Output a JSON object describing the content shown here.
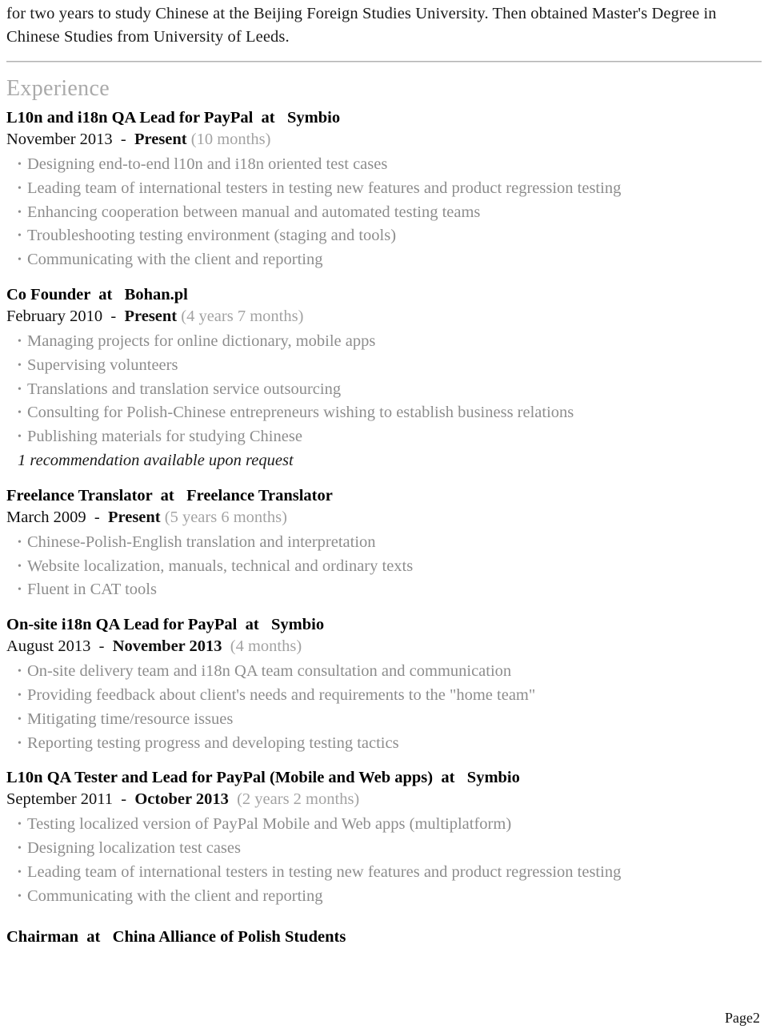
{
  "document": {
    "intro_paragraph": "for two years to study Chinese at the Beijing Foreign Studies University. Then obtained Master's Degree in Chinese Studies from University of Leeds.",
    "footer_page_label": "Page2"
  },
  "experience": {
    "section_title": "Experience",
    "bullet_glyph": "•",
    "jobs": [
      {
        "title": "L10n and i18n QA Lead for PayPal  at   Symbio",
        "date_start": "November 2013  -  ",
        "date_end": "Present",
        "date_end_bold": true,
        "duration": " (10 months)",
        "bullets": [
          "Designing end-to-end l10n and i18n oriented test cases",
          "Leading team of international testers in testing new features and product regression testing",
          "Enhancing cooperation between manual and automated testing teams",
          "Troubleshooting testing environment (staging and tools)",
          "Communicating with the client and reporting"
        ],
        "recommendation": null
      },
      {
        "title": "Co Founder  at   Bohan.pl",
        "date_start": "February 2010  -  ",
        "date_end": "Present",
        "date_end_bold": true,
        "duration": " (4 years 7 months)",
        "bullets": [
          "Managing projects for online dictionary, mobile apps",
          "Supervising volunteers",
          "Translations and translation service outsourcing",
          "Consulting for Polish-Chinese entrepreneurs wishing to establish business relations",
          "Publishing materials for studying Chinese"
        ],
        "recommendation": "1 recommendation available upon request"
      },
      {
        "title": "Freelance Translator  at   Freelance Translator",
        "date_start": "March 2009  -  ",
        "date_end": "Present",
        "date_end_bold": true,
        "duration": " (5 years 6 months)",
        "bullets": [
          "Chinese-Polish-English translation and interpretation",
          "Website localization, manuals, technical and ordinary texts",
          "Fluent in CAT tools"
        ],
        "recommendation": null
      },
      {
        "title": "On-site i18n QA Lead for PayPal  at   Symbio",
        "date_start": "August 2013  -  ",
        "date_end": "November 2013",
        "date_end_bold": true,
        "duration": "  (4 months)",
        "bullets": [
          "On-site delivery team and i18n QA team consultation and communication",
          "Providing feedback about client's needs and requirements to the \"home team\"",
          "Mitigating time/resource issues",
          "Reporting testing progress and developing testing tactics"
        ],
        "recommendation": null
      },
      {
        "title": "L10n QA Tester and Lead for PayPal (Mobile and Web apps)  at   Symbio",
        "date_start": "September 2011  -  ",
        "date_end": "October 2013",
        "date_end_bold": true,
        "duration": "  (2 years 2 months)",
        "bullets": [
          "Testing localized version of PayPal Mobile and Web apps (multiplatform)",
          "Designing localization test cases",
          "Leading team of international testers in testing new features and product regression testing",
          "Communicating with the client and reporting"
        ],
        "recommendation": null
      },
      {
        "title": "Chairman  at   China Alliance of Polish Students",
        "date_start": null,
        "date_end": null,
        "date_end_bold": false,
        "duration": null,
        "bullets": [],
        "recommendation": null
      }
    ]
  }
}
